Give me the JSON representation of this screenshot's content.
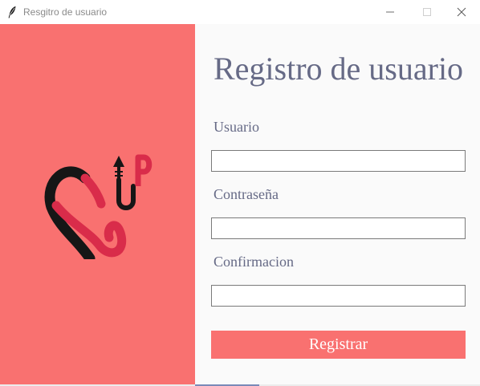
{
  "window": {
    "title": "Resgitro de usuario",
    "icon": "feather-icon"
  },
  "controls": {
    "minimize_icon": "minimize-icon",
    "maximize_icon": "maximize-icon",
    "close_icon": "close-icon"
  },
  "form": {
    "heading": "Registro de usuario",
    "username_label": "Usuario",
    "username_value": "",
    "password_label": "Contraseña",
    "password_value": "",
    "confirm_label": "Confirmacion",
    "confirm_value": "",
    "submit_label": "Registrar"
  },
  "logo": {
    "letters": "SUP",
    "icon": "sup-logo"
  },
  "colors": {
    "accent": "#f97170",
    "text": "#666a86",
    "panel_background": "#fafafa",
    "logo_dark": "#161616",
    "logo_red": "#d92c4a"
  }
}
